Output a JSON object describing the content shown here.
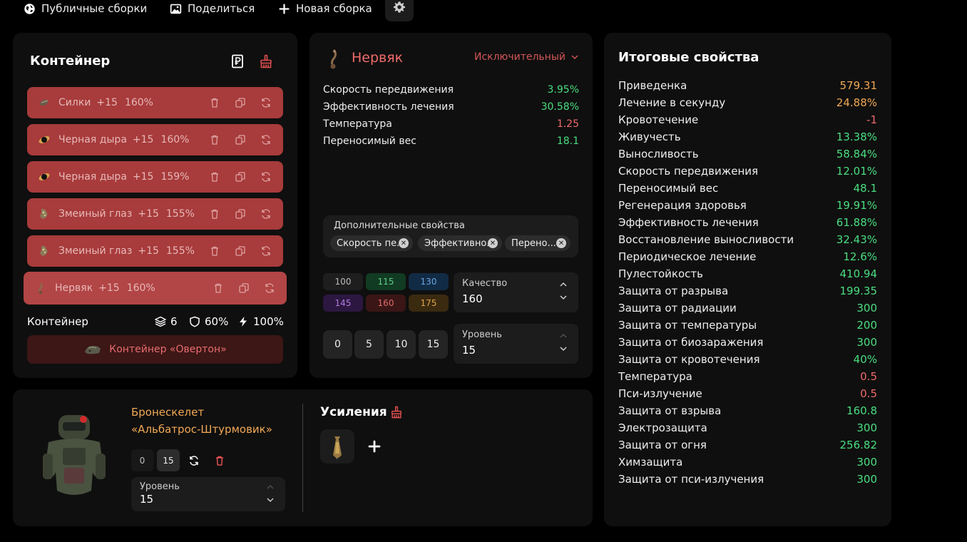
{
  "topbar": {
    "public_builds": "Публичные сборки",
    "share": "Поделиться",
    "new_build": "Новая сборка"
  },
  "container": {
    "title": "Контейнер",
    "slots": [
      {
        "name": "Силки",
        "level": "+15",
        "quality": "160%"
      },
      {
        "name": "Черная дыра",
        "level": "+15",
        "quality": "160%"
      },
      {
        "name": "Черная дыра",
        "level": "+15",
        "quality": "159%"
      },
      {
        "name": "Змеиный глаз",
        "level": "+15",
        "quality": "155%"
      },
      {
        "name": "Змеиный глаз",
        "level": "+15",
        "quality": "155%"
      },
      {
        "name": "Нервяк",
        "level": "+15",
        "quality": "160%"
      }
    ],
    "info_label": "Контейнер",
    "capacity": "6",
    "protection": "60%",
    "efficiency": "100%",
    "container_name": "Контейнер «Овертон»"
  },
  "artifact": {
    "name": "Нервяк",
    "rarity": "Исключительный",
    "stats": [
      {
        "label": "Скорость передвижения",
        "value": "3.95%",
        "color": "#4ade80"
      },
      {
        "label": "Эффективность лечения",
        "value": "30.58%",
        "color": "#4ade80"
      },
      {
        "label": "Температура",
        "value": "1.25",
        "color": "#ef6b6b"
      },
      {
        "label": "Переносимый вес",
        "value": "18.1",
        "color": "#4ade80"
      }
    ],
    "additional_label": "Дополнительные свойства",
    "chips": [
      "Скорость пе...",
      "Эффективно...",
      "Перено..."
    ],
    "quality_presets": [
      "100",
      "115",
      "130",
      "145",
      "160",
      "175"
    ],
    "quality_label": "Качество",
    "quality_value": "160",
    "level_presets": [
      "0",
      "5",
      "10",
      "15"
    ],
    "level_label": "Уровень",
    "level_value": "15"
  },
  "total": {
    "title": "Итоговые свойства",
    "stats": [
      {
        "label": "Приведенка",
        "value": "579.31",
        "color": "#f0a855"
      },
      {
        "label": "Лечение в секунду",
        "value": "24.88%",
        "color": "#f0a855"
      },
      {
        "label": "Кровотечение",
        "value": "-1",
        "color": "#ef6b6b"
      },
      {
        "label": "Живучесть",
        "value": "13.38%",
        "color": "#4ade80"
      },
      {
        "label": "Выносливость",
        "value": "58.84%",
        "color": "#4ade80"
      },
      {
        "label": "Скорость передвижения",
        "value": "12.01%",
        "color": "#4ade80"
      },
      {
        "label": "Переносимый вес",
        "value": "48.1",
        "color": "#4ade80"
      },
      {
        "label": "Регенерация здоровья",
        "value": "19.91%",
        "color": "#4ade80"
      },
      {
        "label": "Эффективность лечения",
        "value": "61.88%",
        "color": "#4ade80"
      },
      {
        "label": "Восстановление выносливости",
        "value": "32.43%",
        "color": "#4ade80"
      },
      {
        "label": "Периодическое лечение",
        "value": "12.6%",
        "color": "#4ade80"
      },
      {
        "label": "Пулестойкость",
        "value": "410.94",
        "color": "#4ade80"
      },
      {
        "label": "Защита от разрыва",
        "value": "199.35",
        "color": "#4ade80"
      },
      {
        "label": "Защита от радиации",
        "value": "300",
        "color": "#4ade80"
      },
      {
        "label": "Защита от температуры",
        "value": "200",
        "color": "#4ade80"
      },
      {
        "label": "Защита от биозаражения",
        "value": "300",
        "color": "#4ade80"
      },
      {
        "label": "Защита от кровотечения",
        "value": "40%",
        "color": "#4ade80"
      },
      {
        "label": "Температура",
        "value": "0.5",
        "color": "#ef6b6b"
      },
      {
        "label": "Пси-излучение",
        "value": "0.5",
        "color": "#ef6b6b"
      },
      {
        "label": "Защита от взрыва",
        "value": "160.8",
        "color": "#4ade80"
      },
      {
        "label": "Электрозащита",
        "value": "300",
        "color": "#4ade80"
      },
      {
        "label": "Защита от огня",
        "value": "256.82",
        "color": "#4ade80"
      },
      {
        "label": "Химзащита",
        "value": "300",
        "color": "#4ade80"
      },
      {
        "label": "Защита от пси-излучения",
        "value": "300",
        "color": "#4ade80"
      }
    ]
  },
  "armor": {
    "name_line1": "Бронескелет",
    "name_line2": "«Альбатрос-Штурмовик»",
    "presets": [
      "0",
      "15"
    ],
    "level_label": "Уровень",
    "level_value": "15",
    "boosts_title": "Усиления"
  }
}
